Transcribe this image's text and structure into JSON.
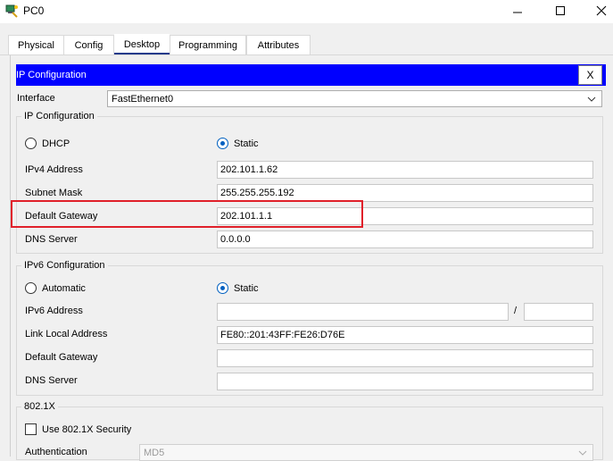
{
  "window": {
    "title": "PC0"
  },
  "tabs": [
    {
      "label": "Physical"
    },
    {
      "label": "Config"
    },
    {
      "label": "Desktop",
      "active": true
    },
    {
      "label": "Programming"
    },
    {
      "label": "Attributes"
    }
  ],
  "ip_config": {
    "header_title": "IP Configuration",
    "close_label": "X",
    "interface_label": "Interface",
    "interface_value": "FastEthernet0",
    "ipv4_group": {
      "legend": "IP Configuration",
      "dhcp_label": "DHCP",
      "static_label": "Static",
      "selected": "Static",
      "ipv4_address_label": "IPv4 Address",
      "ipv4_address_value": "202.101.1.62",
      "subnet_mask_label": "Subnet Mask",
      "subnet_mask_value": "255.255.255.192",
      "default_gateway_label": "Default Gateway",
      "default_gateway_value": "202.101.1.1",
      "dns_server_label": "DNS Server",
      "dns_server_value": "0.0.0.0"
    },
    "ipv6_group": {
      "legend": "IPv6 Configuration",
      "automatic_label": "Automatic",
      "static_label": "Static",
      "selected": "Static",
      "ipv6_address_label": "IPv6 Address",
      "ipv6_address_value": "",
      "prefix_separator": "/",
      "prefix_value": "",
      "link_local_label": "Link Local Address",
      "link_local_value": "FE80::201:43FF:FE26:D76E",
      "default_gateway_label": "Default Gateway",
      "default_gateway_value": "",
      "dns_server_label": "DNS Server",
      "dns_server_value": ""
    },
    "dot1x_group": {
      "legend": "802.1X",
      "use_label": "Use 802.1X Security",
      "use_checked": false,
      "authentication_label": "Authentication",
      "authentication_value": "MD5"
    }
  },
  "colors": {
    "header_bar": "#0000ff",
    "highlight": "#e0202a",
    "radio_selected": "#0060c0"
  }
}
